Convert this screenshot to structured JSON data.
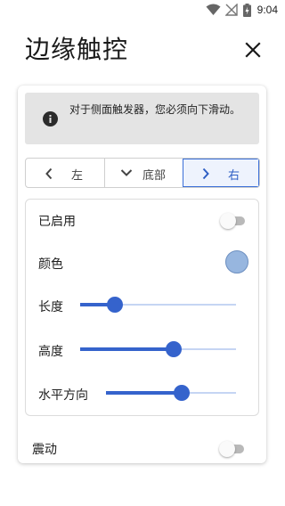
{
  "status_bar": {
    "time": "9:04"
  },
  "page": {
    "title": "边缘触控"
  },
  "notice": {
    "text": "对于侧面触发器，您必须向下滑动。",
    "icon": "info-icon"
  },
  "position_tabs": [
    {
      "label": "左",
      "icon": "chevron-left-icon",
      "selected": false
    },
    {
      "label": "底部",
      "icon": "chevron-down-icon",
      "selected": false
    },
    {
      "label": "右",
      "icon": "chevron-right-icon",
      "selected": true
    }
  ],
  "settings": {
    "enabled": {
      "label": "已启用",
      "on": false
    },
    "color": {
      "label": "颜色",
      "value": "#97b6df"
    },
    "length": {
      "label": "长度",
      "value": 0.22
    },
    "height": {
      "label": "高度",
      "value": 0.6
    },
    "horizontal": {
      "label": "水平方向",
      "value": 0.58
    }
  },
  "vibration": {
    "label": "震动",
    "on": false
  },
  "colors": {
    "accent": "#3563cc",
    "selected_tab_bg": "#eef3fd"
  }
}
